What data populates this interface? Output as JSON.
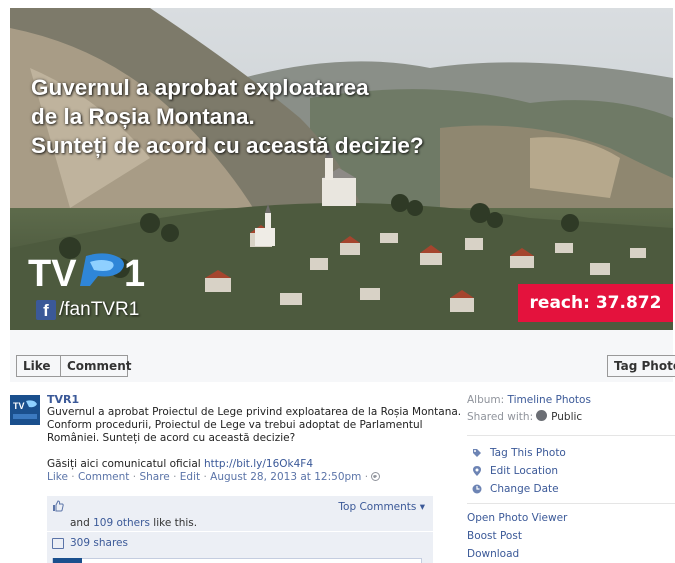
{
  "photo": {
    "headline_lines": [
      "Guvernul a aprobat exploatarea",
      "de la Roșia Montana.",
      "Sunteți de acord cu această decizie?"
    ],
    "logo_text": "TVR1",
    "fan_page": "/fanTVR1",
    "reach": "reach: 37.872"
  },
  "actions": {
    "like": "Like",
    "comment": "Comment",
    "tag_photo": "Tag Photo"
  },
  "post": {
    "page_name": "TVR1",
    "text_lines": [
      "Guvernul a aprobat Proiectul de Lege privind exploatarea de la Roșia Montana.",
      "Conform procedurii, Proiectul de Lege va trebui adoptat de Parlamentul",
      "României. Sunteți de acord cu această decizie?"
    ],
    "official_prefix": "Găsiți aici comunicatul oficial",
    "official_link": "http://bit.ly/16Ok4F4",
    "meta": {
      "like": "Like",
      "comment": "Comment",
      "share": "Share",
      "edit": "Edit",
      "date": "August 28, 2013 at 12:50pm",
      "sep": "·"
    },
    "ufi": {
      "top_comments": "Top Comments ▾",
      "likes_prefix": "and",
      "likes_link": "109 others",
      "likes_suffix": "like this.",
      "shares": "309 shares"
    }
  },
  "sidebar": {
    "album_label": "Album:",
    "album_name": "Timeline Photos",
    "shared_label": "Shared with:",
    "shared_value": "Public",
    "actions": [
      "Tag This Photo",
      "Edit Location",
      "Change Date"
    ],
    "links": [
      "Open Photo Viewer",
      "Boost Post",
      "Download"
    ]
  },
  "colors": {
    "brand_blue": "#3b5998",
    "reach_red": "#e4123d",
    "ufi_bg": "#eceff5"
  }
}
